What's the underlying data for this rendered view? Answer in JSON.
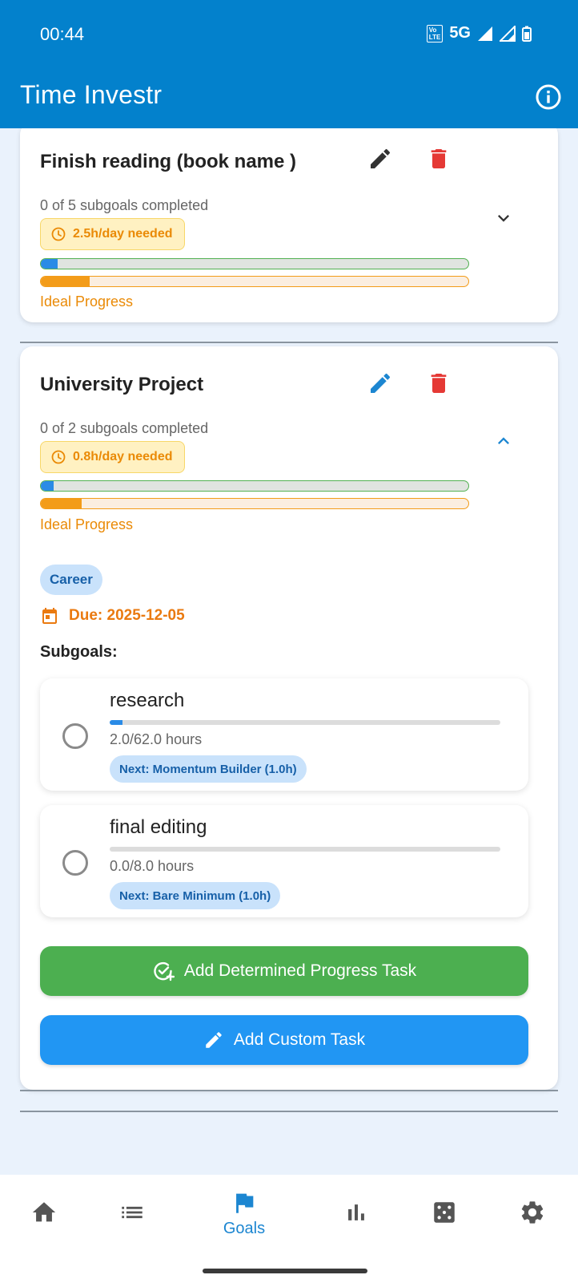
{
  "status_bar": {
    "time": "00:44",
    "volte": "Vo LTE 2",
    "network": "5G"
  },
  "app": {
    "title": "Time Investr"
  },
  "goals": [
    {
      "title": "Finish reading (book name )",
      "subgoals_text": "0 of 5 subgoals completed",
      "needed": "2.5h/day needed",
      "progress": 0.04,
      "ideal_progress": 0.115,
      "ideal_label": "Ideal Progress",
      "expanded": false
    },
    {
      "title": "University Project",
      "subgoals_text": "0 of 2 subgoals completed",
      "needed": "0.8h/day needed",
      "progress": 0.03,
      "ideal_progress": 0.095,
      "ideal_label": "Ideal Progress",
      "expanded": true,
      "category": "Career",
      "due": "Due: 2025-12-05",
      "subgoals_heading": "Subgoals:",
      "subgoals": [
        {
          "name": "research",
          "hours": "2.0/62.0 hours",
          "progress": 0.032,
          "next": "Next: Momentum Builder (1.0h)"
        },
        {
          "name": "final editing",
          "hours": "0.0/8.0 hours",
          "progress": 0.0,
          "next": "Next: Bare Minimum (1.0h)"
        }
      ],
      "buttons": {
        "determined": "Add Determined Progress Task",
        "custom": "Add Custom Task"
      }
    }
  ],
  "bottom_nav": {
    "items": [
      {
        "icon": "home-icon",
        "label": ""
      },
      {
        "icon": "list-icon",
        "label": ""
      },
      {
        "icon": "flag-icon",
        "label": "Goals",
        "active": true
      },
      {
        "icon": "bar-chart-icon",
        "label": ""
      },
      {
        "icon": "dice-icon",
        "label": ""
      },
      {
        "icon": "settings-icon",
        "label": ""
      }
    ]
  },
  "colors": {
    "primary": "#0381cc",
    "background": "#eaf2fc",
    "progress_blue": "#2a8be6",
    "progress_green_border": "#53b153",
    "ideal_orange": "#f39c19",
    "delete_red": "#e53935",
    "determined_button": "#4caf50",
    "custom_button": "#2196f3"
  }
}
